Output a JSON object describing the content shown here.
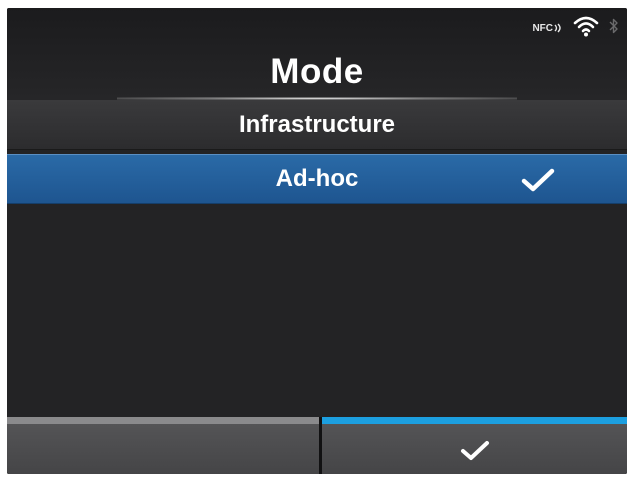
{
  "header": {
    "title": "Mode",
    "status_icons": {
      "nfc_label": "NFC",
      "icons": [
        "nfc-icon",
        "wifi-icon",
        "bluetooth-icon"
      ]
    }
  },
  "mode_list": {
    "items": [
      {
        "label": "Infrastructure",
        "selected": false
      },
      {
        "label": "Ad-hoc",
        "selected": true,
        "icon": "check-icon"
      }
    ]
  },
  "soft_keys": {
    "left": {
      "label": "",
      "strip_color": "#8a8a8c"
    },
    "right": {
      "label": "",
      "icon": "check-icon",
      "strip_color": "#1c9fe0"
    }
  },
  "colors": {
    "background": "#232325",
    "selected_row": "#2365a0",
    "accent_blue": "#1c9fe0",
    "text": "#ffffff"
  }
}
